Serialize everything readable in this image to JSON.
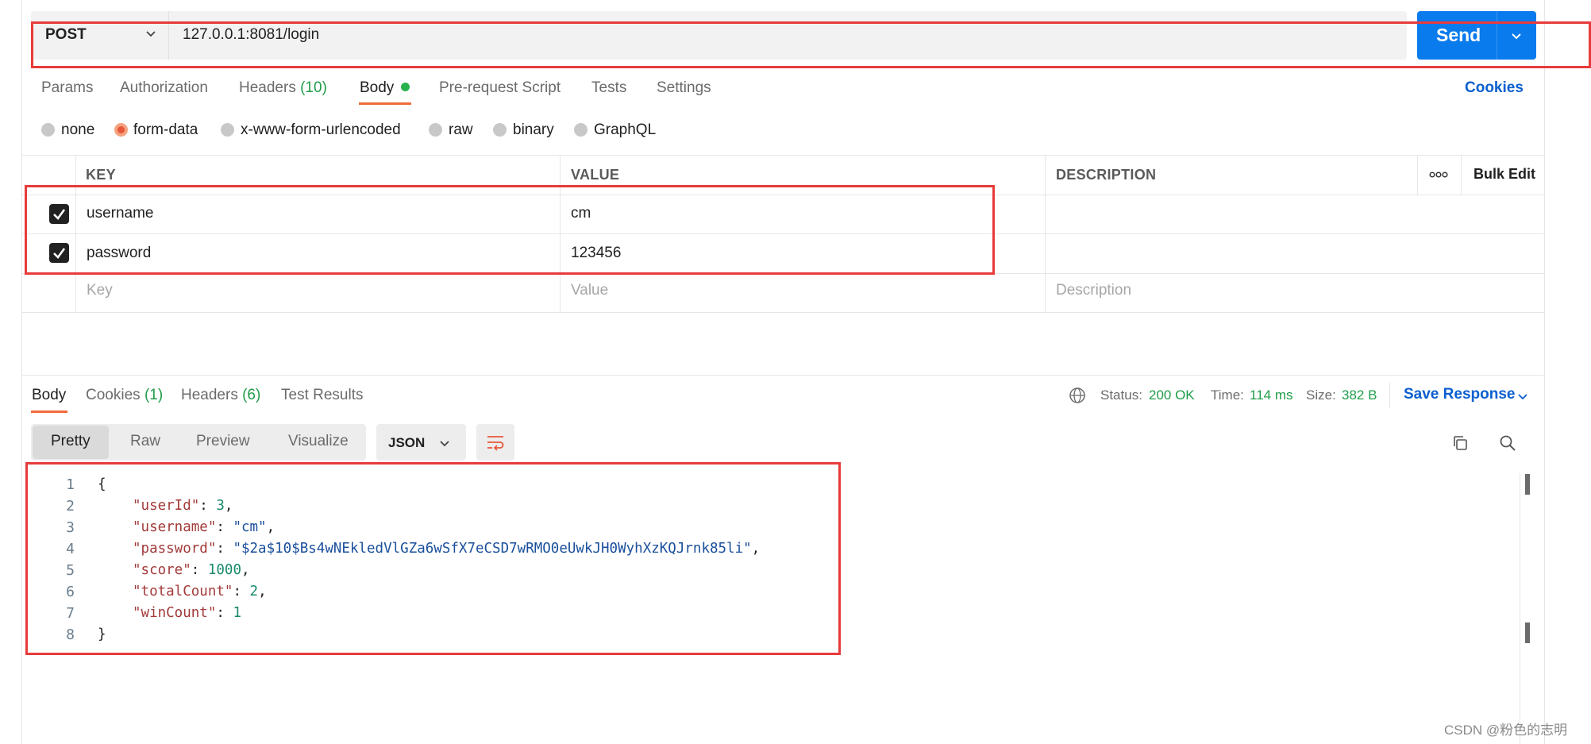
{
  "request": {
    "method": "POST",
    "url": "127.0.0.1:8081/login",
    "send_label": "Send"
  },
  "request_tabs": {
    "params": "Params",
    "authorization": "Authorization",
    "headers": "Headers",
    "headers_count": "(10)",
    "body": "Body",
    "prerequest": "Pre-request Script",
    "tests": "Tests",
    "settings": "Settings",
    "cookies": "Cookies"
  },
  "body_types": {
    "selected": "form-data",
    "options": [
      "none",
      "form-data",
      "x-www-form-urlencoded",
      "raw",
      "binary",
      "GraphQL"
    ]
  },
  "params_table": {
    "headers": {
      "key": "KEY",
      "value": "VALUE",
      "description": "DESCRIPTION",
      "bulk_edit": "Bulk Edit"
    },
    "rows": [
      {
        "checked": true,
        "key": "username",
        "value": "cm",
        "description": ""
      },
      {
        "checked": true,
        "key": "password",
        "value": "123456",
        "description": ""
      }
    ],
    "placeholders": {
      "key": "Key",
      "value": "Value",
      "description": "Description"
    }
  },
  "response": {
    "tabs": {
      "body": "Body",
      "cookies": "Cookies",
      "cookies_count": "(1)",
      "headers": "Headers",
      "headers_count": "(6)",
      "test_results": "Test Results"
    },
    "status_label": "Status:",
    "status_value": "200 OK",
    "time_label": "Time:",
    "time_value": "114 ms",
    "size_label": "Size:",
    "size_value": "382 B",
    "save_response": "Save Response",
    "views": {
      "pretty": "Pretty",
      "raw": "Raw",
      "preview": "Preview",
      "visualize": "Visualize"
    },
    "format": "JSON",
    "code_lines": [
      {
        "n": "1",
        "text": "{"
      },
      {
        "n": "2",
        "key": "\"userId\"",
        "val": "3",
        "kind": "num",
        "comma": ","
      },
      {
        "n": "3",
        "key": "\"username\"",
        "val": "\"cm\"",
        "kind": "str",
        "comma": ","
      },
      {
        "n": "4",
        "key": "\"password\"",
        "val": "\"$2a$10$Bs4wNEkledVlGZa6wSfX7eCSD7wRMO0eUwkJH0WyhXzKQJrnk85li\"",
        "kind": "str",
        "comma": ","
      },
      {
        "n": "5",
        "key": "\"score\"",
        "val": "1000",
        "kind": "num",
        "comma": ","
      },
      {
        "n": "6",
        "key": "\"totalCount\"",
        "val": "2",
        "kind": "num",
        "comma": ","
      },
      {
        "n": "7",
        "key": "\"winCount\"",
        "val": "1",
        "kind": "num",
        "comma": ""
      },
      {
        "n": "8",
        "text": "}"
      }
    ]
  },
  "watermark": "CSDN @粉色的志明",
  "colors": {
    "accent": "#097bed",
    "tab_underline": "#f26b3a",
    "annotation_red": "#e83b3b",
    "ok_green": "#1f9d4a"
  }
}
